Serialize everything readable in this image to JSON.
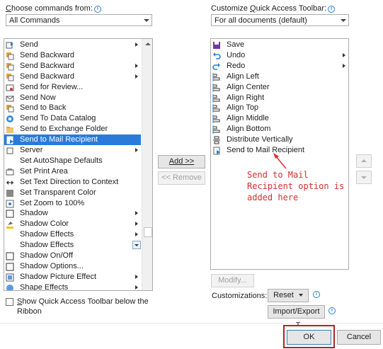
{
  "left": {
    "label_pre": "",
    "label_u": "C",
    "label_post": "hoose commands from:",
    "dropdown_value": "All Commands",
    "items": [
      {
        "label": "Send",
        "icon": "send-icon",
        "sub": true
      },
      {
        "label": "Send Backward",
        "icon": "send-backward-icon",
        "sub": false
      },
      {
        "label": "Send Backward",
        "icon": "send-backward-icon",
        "sub": true
      },
      {
        "label": "Send Backward",
        "icon": "send-backward-icon",
        "sub": true
      },
      {
        "label": "Send for Review...",
        "icon": "send-review-icon",
        "sub": false
      },
      {
        "label": "Send Now",
        "icon": "send-now-icon",
        "sub": false
      },
      {
        "label": "Send to Back",
        "icon": "send-to-back-icon",
        "sub": false
      },
      {
        "label": "Send To Data Catalog",
        "icon": "data-catalog-icon",
        "sub": false
      },
      {
        "label": "Send to Exchange Folder",
        "icon": "exchange-folder-icon",
        "sub": false
      },
      {
        "label": "Send to Mail Recipient",
        "icon": "mail-recipient-icon",
        "sub": false,
        "selected": true
      },
      {
        "label": "Server",
        "icon": "server-icon",
        "sub": true
      },
      {
        "label": "Set AutoShape Defaults",
        "icon": "",
        "sub": false
      },
      {
        "label": "Set Print Area",
        "icon": "print-area-icon",
        "sub": false
      },
      {
        "label": "Set Text Direction to Context",
        "icon": "text-direction-icon",
        "sub": false
      },
      {
        "label": "Set Transparent Color",
        "icon": "transparent-color-icon",
        "sub": false
      },
      {
        "label": "Set Zoom to 100%",
        "icon": "zoom-icon",
        "sub": false
      },
      {
        "label": "Shadow",
        "icon": "shadow-icon",
        "sub": true
      },
      {
        "label": "Shadow Color",
        "icon": "shadow-color-icon",
        "sub": true
      },
      {
        "label": "Shadow Effects",
        "icon": "",
        "sub": true
      },
      {
        "label": "Shadow Effects",
        "icon": "",
        "sub": false,
        "dropbtn": true
      },
      {
        "label": "Shadow On/Off",
        "icon": "shadow-onoff-icon",
        "sub": false
      },
      {
        "label": "Shadow Options...",
        "icon": "shadow-options-icon",
        "sub": false
      },
      {
        "label": "Shadow Picture Effect",
        "icon": "shadow-picture-icon",
        "sub": true
      },
      {
        "label": "Shape Effects",
        "icon": "shape-effects-icon",
        "sub": true
      }
    ],
    "checkbox_label_pre": "",
    "checkbox_label_u": "S",
    "checkbox_label_post": "how Quick Access Toolbar below the",
    "checkbox_label_line2": "Ribbon"
  },
  "right": {
    "label_pre": "Customize ",
    "label_u": "Q",
    "label_post": "uick Access Toolbar:",
    "dropdown_value": "For all documents (default)",
    "items": [
      {
        "label": "Save",
        "icon": "save-icon",
        "sub": false
      },
      {
        "label": "Undo",
        "icon": "undo-icon",
        "sub": true
      },
      {
        "label": "Redo",
        "icon": "redo-icon",
        "sub": true
      },
      {
        "label": "Align Left",
        "icon": "align-left-icon",
        "sub": false
      },
      {
        "label": "Align Center",
        "icon": "align-center-icon",
        "sub": false
      },
      {
        "label": "Align Right",
        "icon": "align-right-icon",
        "sub": false
      },
      {
        "label": "Align Top",
        "icon": "align-top-icon",
        "sub": false
      },
      {
        "label": "Align Middle",
        "icon": "align-middle-icon",
        "sub": false
      },
      {
        "label": "Align Bottom",
        "icon": "align-bottom-icon",
        "sub": false
      },
      {
        "label": "Distribute Vertically",
        "icon": "distribute-vertically-icon",
        "sub": false
      },
      {
        "label": "Send to Mail Recipient",
        "icon": "mail-recipient-icon",
        "sub": false
      }
    ],
    "modify_label": "Modify...",
    "customizations_label": "Customizations:",
    "reset_label": "Reset",
    "import_export_label": "Import/Export"
  },
  "middle": {
    "add_label": "Add >>",
    "remove_label": "<< Remove"
  },
  "annotation": {
    "line1": "Send to Mail",
    "line2": "Recipient option is",
    "line3": "added here",
    "color": "#d32f2f"
  },
  "footer": {
    "ok_label": "OK",
    "cancel_label": "Cancel",
    "highlight_color": "#a4262c"
  },
  "colors": {
    "selection": "#2a7bd9",
    "info": "#2a7fd4"
  }
}
